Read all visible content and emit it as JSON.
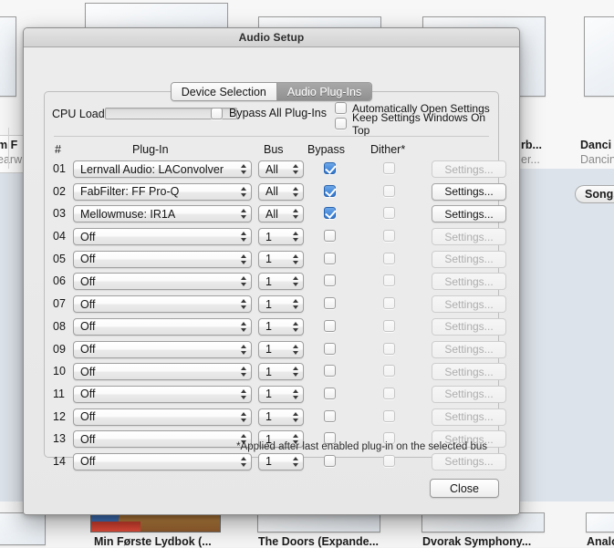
{
  "background": {
    "left_item": {
      "title": "m F",
      "subtitle": "earw"
    },
    "right_items": [
      {
        "title": "rb...",
        "subtitle": "er..."
      },
      {
        "title": "Danci",
        "subtitle": "Dancin"
      }
    ],
    "songs_button": "Songs",
    "bottom_items": [
      {
        "label": "Min Første Lydbok (..."
      },
      {
        "label": "The Doors (Expande..."
      },
      {
        "label": "Dvorak Symphony..."
      },
      {
        "label": "Analo"
      }
    ]
  },
  "dialog": {
    "title": "Audio Setup",
    "tabs": [
      {
        "label": "Device Selection",
        "selected": false
      },
      {
        "label": "Audio Plug-Ins",
        "selected": true
      }
    ],
    "cpu_load_label": "CPU Load",
    "cpu_load_value": 0,
    "bypass_all": {
      "label": "Bypass All Plug-Ins",
      "checked": false
    },
    "options": [
      {
        "label": "Automatically Open Settings",
        "checked": false
      },
      {
        "label": "Keep Settings Windows On Top",
        "checked": false
      }
    ],
    "table": {
      "headers": {
        "num": "#",
        "plugin": "Plug-In",
        "bus": "Bus",
        "bypass": "Bypass",
        "dither": "Dither*"
      },
      "settings_label": "Settings...",
      "rows": [
        {
          "num": "01",
          "plugin": "Lernvall Audio: LAConvolver",
          "bus": "All",
          "bypass": true,
          "dither": false,
          "settings_enabled": false
        },
        {
          "num": "02",
          "plugin": "FabFilter: FF Pro-Q",
          "bus": "All",
          "bypass": true,
          "dither": false,
          "settings_enabled": true
        },
        {
          "num": "03",
          "plugin": "Mellowmuse: IR1A",
          "bus": "All",
          "bypass": true,
          "dither": false,
          "settings_enabled": true
        },
        {
          "num": "04",
          "plugin": "Off",
          "bus": "1",
          "bypass": false,
          "dither": false,
          "settings_enabled": false
        },
        {
          "num": "05",
          "plugin": "Off",
          "bus": "1",
          "bypass": false,
          "dither": false,
          "settings_enabled": false
        },
        {
          "num": "06",
          "plugin": "Off",
          "bus": "1",
          "bypass": false,
          "dither": false,
          "settings_enabled": false
        },
        {
          "num": "07",
          "plugin": "Off",
          "bus": "1",
          "bypass": false,
          "dither": false,
          "settings_enabled": false
        },
        {
          "num": "08",
          "plugin": "Off",
          "bus": "1",
          "bypass": false,
          "dither": false,
          "settings_enabled": false
        },
        {
          "num": "09",
          "plugin": "Off",
          "bus": "1",
          "bypass": false,
          "dither": false,
          "settings_enabled": false
        },
        {
          "num": "10",
          "plugin": "Off",
          "bus": "1",
          "bypass": false,
          "dither": false,
          "settings_enabled": false
        },
        {
          "num": "11",
          "plugin": "Off",
          "bus": "1",
          "bypass": false,
          "dither": false,
          "settings_enabled": false
        },
        {
          "num": "12",
          "plugin": "Off",
          "bus": "1",
          "bypass": false,
          "dither": false,
          "settings_enabled": false
        },
        {
          "num": "13",
          "plugin": "Off",
          "bus": "1",
          "bypass": false,
          "dither": false,
          "settings_enabled": false
        },
        {
          "num": "14",
          "plugin": "Off",
          "bus": "1",
          "bypass": false,
          "dither": false,
          "settings_enabled": false
        }
      ]
    },
    "footnote": "*Applied after last enabled plug-in on the selected bus",
    "close_label": "Close"
  },
  "colors": {
    "checkbox_checked": "#2f76d0",
    "tab_selected_bg": "#909090",
    "dialog_bg": "#ebebeb",
    "backdrop_mid": "#dde3ea"
  }
}
